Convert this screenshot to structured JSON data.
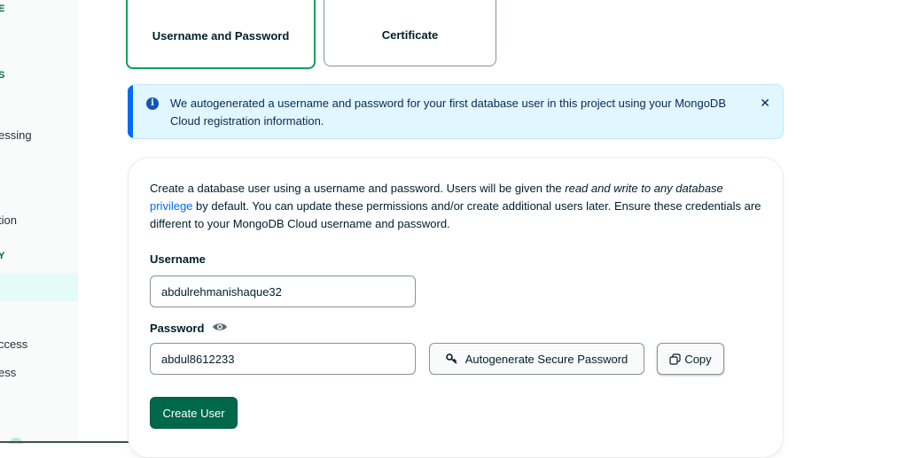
{
  "sidebar": {
    "heading_top": "E",
    "item_s": "S",
    "item_essing": "essing",
    "item_tion": "tion",
    "heading_y": "Y",
    "item_ccess": "ccess",
    "item_ess": "ess"
  },
  "auth_methods": {
    "username_password": "Username and Password",
    "certificate": "Certificate",
    "selected": "Username and Password"
  },
  "banner": {
    "text": "We autogenerated a username and password for your first database user in this project using your MongoDB Cloud registration information.",
    "info_icon": "info-icon",
    "close_icon": "close-icon",
    "close_glyph": "✕"
  },
  "form": {
    "desc_part1": "Create a database user using a username and password. Users will be given the ",
    "desc_italic1": "read and write to any database",
    "desc_link": "privilege",
    "desc_part2": " by default. You can update these permissions and/or create additional users later. Ensure these credentials are different to your MongoDB Cloud username and password.",
    "username_label": "Username",
    "username_value": "abdulrehmanishaque32",
    "password_label": "Password",
    "password_value": "abdul8612233",
    "autogenerate_label": "Autogenerate Secure Password",
    "copy_label": "Copy",
    "create_user_label": "Create User"
  },
  "colors": {
    "primary_green": "#00684a",
    "selected_border": "#00a35c",
    "banner_bg": "#e1f7ff",
    "banner_accent": "#016bf8",
    "link": "#016bf8"
  }
}
